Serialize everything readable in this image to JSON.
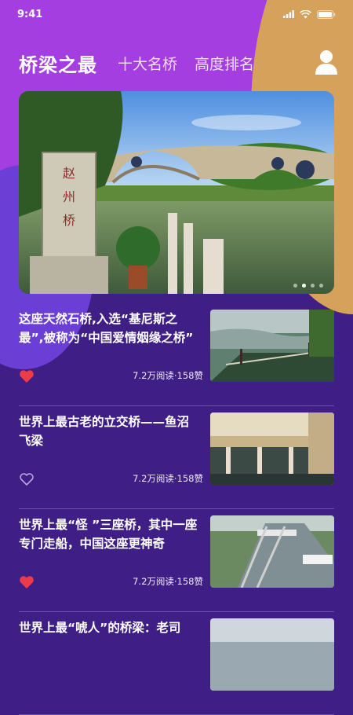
{
  "status": {
    "time": "9:41"
  },
  "header": {
    "tabs": [
      {
        "label": "桥梁之最"
      },
      {
        "label": "十大名桥"
      },
      {
        "label": "高度排名"
      }
    ]
  },
  "banner": {
    "slide_count": 4,
    "active_slide": 2
  },
  "articles": [
    {
      "title": "这座天然石桥,入选“基尼斯之最”,被称为“中国爱情姻缘之桥”",
      "meta": "7.2万阅读·158赞",
      "liked": true
    },
    {
      "title": "世界上最古老的立交桥——鱼沼飞梁",
      "meta": "7.2万阅读·158赞",
      "liked": false
    },
    {
      "title": "世界上最“怪 ”三座桥，其中一座专门走船，中国这座更神奇",
      "meta": "7.2万阅读·158赞",
      "liked": true
    },
    {
      "title": "世界上最“唬人”的桥梁：老司",
      "meta": "",
      "liked": false
    }
  ],
  "colors": {
    "background": "#3f1f86",
    "accent_magenta": "#a43ee0",
    "accent_orange": "#d6a15a",
    "heart": "#ee3b4a"
  }
}
